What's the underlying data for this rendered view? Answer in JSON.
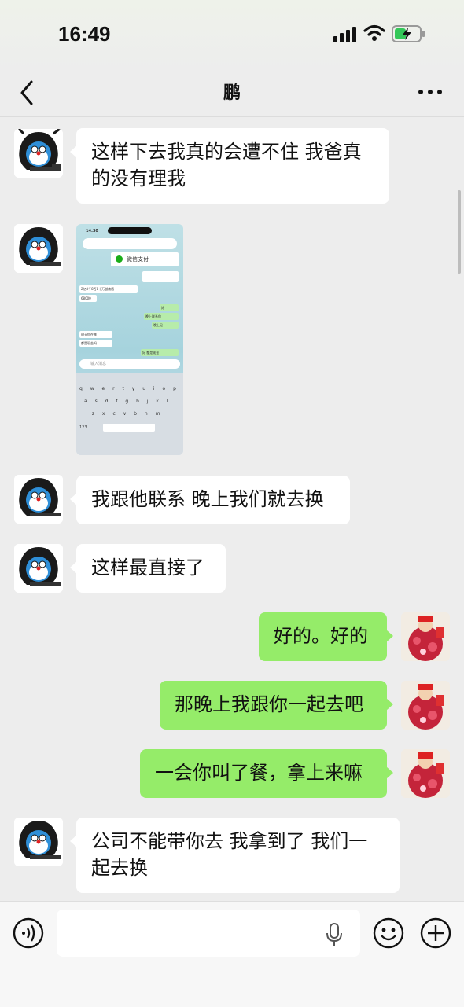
{
  "status_bar": {
    "time": "16:49"
  },
  "header": {
    "title": "鹏"
  },
  "messages": [
    {
      "side": "left",
      "text": "这样下去我真的会遭不住 我爸真的没有理我"
    },
    {
      "side": "left",
      "type": "image",
      "description": "screenshot"
    },
    {
      "side": "left",
      "text": "我跟他联系 晚上我们就去换"
    },
    {
      "side": "left",
      "text": "这样最直接了"
    },
    {
      "side": "right",
      "text": "好的。好的"
    },
    {
      "side": "right",
      "text": "那晚上我跟你一起去吧"
    },
    {
      "side": "right",
      "text": "一会你叫了餐，拿上来嘛"
    },
    {
      "side": "left",
      "text": "公司不能带你去  我拿到了 我们一起去换"
    }
  ],
  "inner_screenshot": {
    "time": "14:30",
    "pay_label": "微信支付",
    "bubble_1": "2亿8千8百8十万越南盾",
    "bubble_2": "68000",
    "bubble_3": "好",
    "bubble_4": "晚上联系你",
    "bubble_5": "晚上见",
    "bubble_6": "明天你在哪",
    "bubble_7": "都是现金吗",
    "bubble_8": "好 都是现金",
    "input_placeholder": "输入消息",
    "keys_row1": "q w e r t y u i o p",
    "keys_row2": "a s d f g h j k l",
    "keys_row3": "z x c v b n m",
    "key_123": "123"
  },
  "colors": {
    "bubble_right": "#95ec69",
    "bubble_left": "#ffffff",
    "background": "#ededed"
  },
  "icons": [
    "back-icon",
    "more-icon",
    "voice-icon",
    "mic-icon",
    "emoji-icon",
    "plus-icon"
  ]
}
